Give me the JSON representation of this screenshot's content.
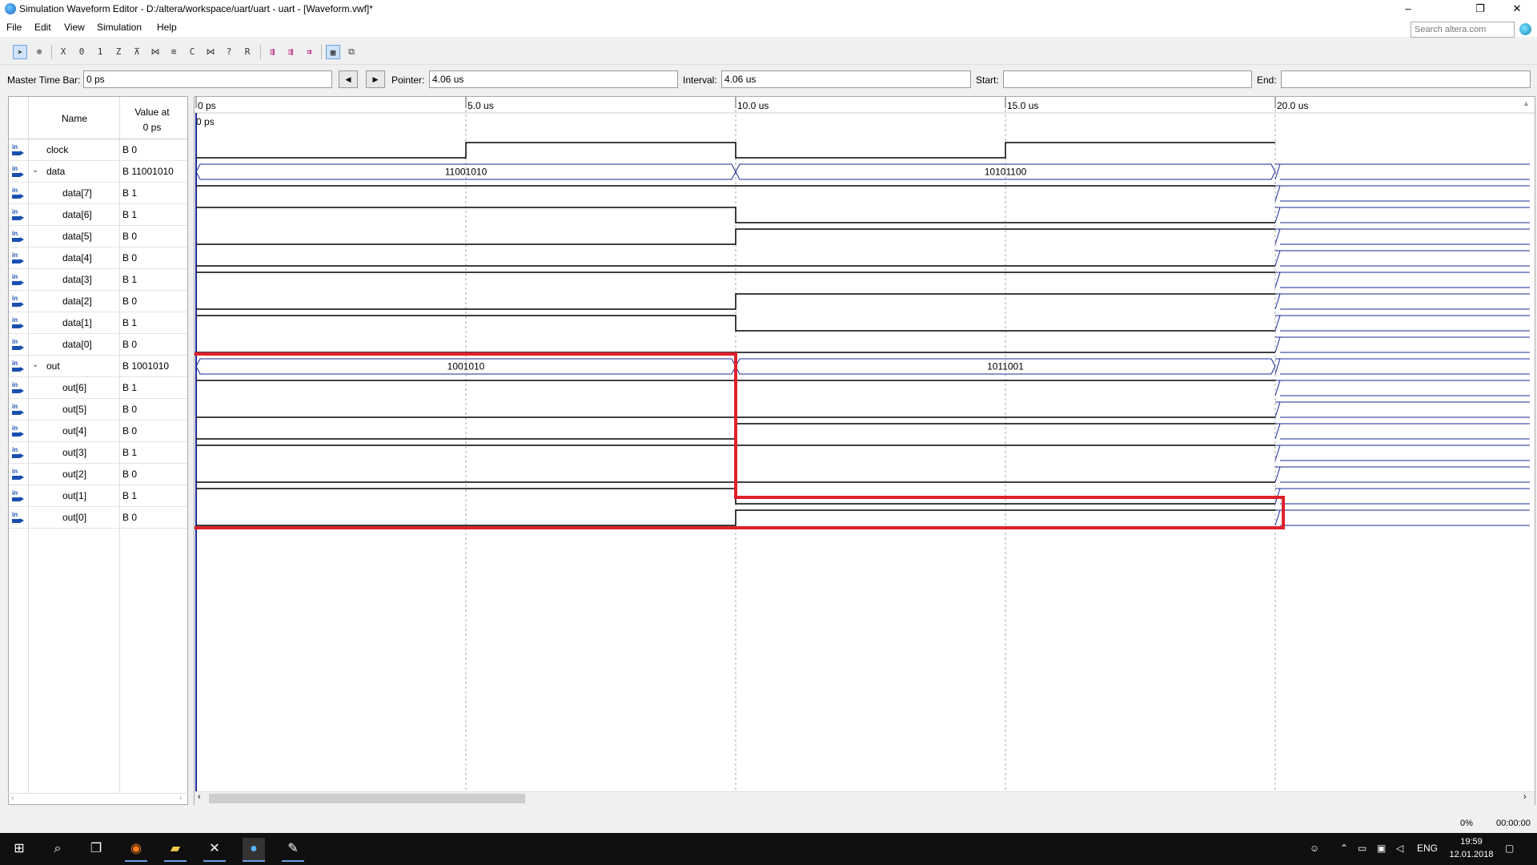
{
  "window": {
    "title": "Simulation Waveform Editor - D:/altera/workspace/uart/uart - uart - [Waveform.vwf]*",
    "minimize_icon": "–",
    "restore_icon": "❐",
    "close_icon": "✕"
  },
  "menu": [
    {
      "label": "File"
    },
    {
      "label": "Edit"
    },
    {
      "label": "View"
    },
    {
      "label": "Simulation"
    },
    {
      "label": "Help"
    }
  ],
  "search": {
    "placeholder": "Search altera.com"
  },
  "toolbar_icons": [
    "pointer-tool-icon",
    "zoom-tool-icon",
    "waveform-x-icon",
    "force-low-icon",
    "force-high-icon",
    "invert-icon",
    "overwrite-clock-icon",
    "count-value-icon",
    "random-value-icon",
    "weak-low-icon",
    "weak-high-icon",
    "dont-care-icon",
    "high-z-icon",
    "grid-icon",
    "run-functional-sim-icon",
    "run-timing-sim-icon",
    "run-netlist-sim-icon",
    "snap-to-grid-icon",
    "group-icon"
  ],
  "timebar": {
    "master_label": "Master Time Bar:",
    "master_value": "0 ps",
    "prev_icon": "◀",
    "next_icon": "▶",
    "pointer_label": "Pointer:",
    "pointer_value": "4.06 us",
    "interval_label": "Interval:",
    "interval_value": "4.06 us",
    "start_label": "Start:",
    "start_value": "",
    "end_label": "End:",
    "end_value": ""
  },
  "signal_table": {
    "col_name": "Name",
    "col_value_line1": "Value at",
    "col_value_line2": "0 ps",
    "pin_text": "in",
    "expand_icon": "⌄",
    "rows": [
      {
        "name": "clock",
        "value": "B 0"
      },
      {
        "name": "data",
        "value": "B 11001010",
        "expandable": true
      },
      {
        "name": "data[7]",
        "value": "B 1"
      },
      {
        "name": "data[6]",
        "value": "B 1"
      },
      {
        "name": "data[5]",
        "value": "B 0"
      },
      {
        "name": "data[4]",
        "value": "B 0"
      },
      {
        "name": "data[3]",
        "value": "B 1"
      },
      {
        "name": "data[2]",
        "value": "B 0"
      },
      {
        "name": "data[1]",
        "value": "B 1"
      },
      {
        "name": "data[0]",
        "value": "B 0"
      },
      {
        "name": "out",
        "value": "B 1001010",
        "expandable": true
      },
      {
        "name": "out[6]",
        "value": "B 1"
      },
      {
        "name": "out[5]",
        "value": "B 0"
      },
      {
        "name": "out[4]",
        "value": "B 0"
      },
      {
        "name": "out[3]",
        "value": "B 1"
      },
      {
        "name": "out[2]",
        "value": "B 0"
      },
      {
        "name": "out[1]",
        "value": "B 1"
      },
      {
        "name": "out[0]",
        "value": "B 0"
      }
    ]
  },
  "waveform": {
    "time_unit": "us",
    "end_time": 20.0,
    "tick_labels": [
      "0 ps",
      "5.0 us",
      "10.0 us",
      "15.0 us",
      "20.0 us"
    ],
    "tick_times": [
      0,
      5.0,
      10.0,
      15.0,
      20.0
    ],
    "cursor_label": "0 ps",
    "highlight_color": "#e0202a",
    "bus_color": "#1a2a9a",
    "data_bus": {
      "segments": [
        {
          "from": 0,
          "to": 10,
          "value": "11001010"
        },
        {
          "from": 10,
          "to": 20,
          "value": "10101100"
        }
      ]
    },
    "out_bus": {
      "segments": [
        {
          "from": 0,
          "to": 10,
          "value": "1001010"
        },
        {
          "from": 10,
          "to": 20,
          "value": "1011001"
        }
      ]
    },
    "clock": [
      {
        "t": 0,
        "v": 0
      },
      {
        "t": 5,
        "v": 1
      },
      {
        "t": 10,
        "v": 0
      },
      {
        "t": 15,
        "v": 1
      },
      {
        "t": 20,
        "v": 0
      }
    ]
  },
  "statusbar": {
    "progress": "0%",
    "time": "00:00:00"
  },
  "taskbar": {
    "language": "ENG",
    "clock_time": "19:59",
    "clock_date": "12.01.2018",
    "apps": [
      "windows-start-icon",
      "search-icon",
      "task-view-icon",
      "firefox-icon",
      "file-explorer-icon",
      "quartus-tools-icon",
      "quartus-icon",
      "paint-icon"
    ]
  }
}
